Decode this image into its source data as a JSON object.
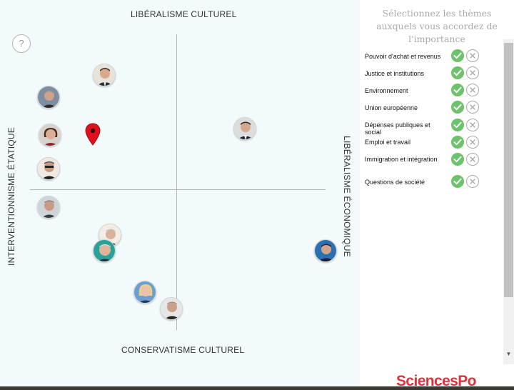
{
  "chart": {
    "axis_top": "LIBÉRALISME CULTUREL",
    "axis_bottom": "CONSERVATISME CULTUREL",
    "axis_left": "INTERVENTIONNISME ÉTATIQUE",
    "axis_right": "LIBÉRALISME ÉCONOMIQUE",
    "help_symbol": "?"
  },
  "themes_panel": {
    "heading": "Sélectionnez les thèmes auxquels vous accordez de l'importance",
    "themes": [
      {
        "label": "Pouvoir d'achat et revenus"
      },
      {
        "label": "Justice et institutions"
      },
      {
        "label": "Environnement"
      },
      {
        "label": "Union européenne"
      },
      {
        "label": "Dépenses publiques et social"
      },
      {
        "label": "Emploi et travail"
      },
      {
        "label": "Immigration et intégration"
      },
      {
        "label": "Questions de société"
      }
    ]
  },
  "brand": "SciencesPo",
  "colors": {
    "check_green": "#6cc36c",
    "marker_red": "#e0101e",
    "brand_red": "#e0323d"
  },
  "icons": {
    "user_marker": "map-pin-icon",
    "include": "check-circle-icon",
    "exclude": "x-circle-icon"
  }
}
